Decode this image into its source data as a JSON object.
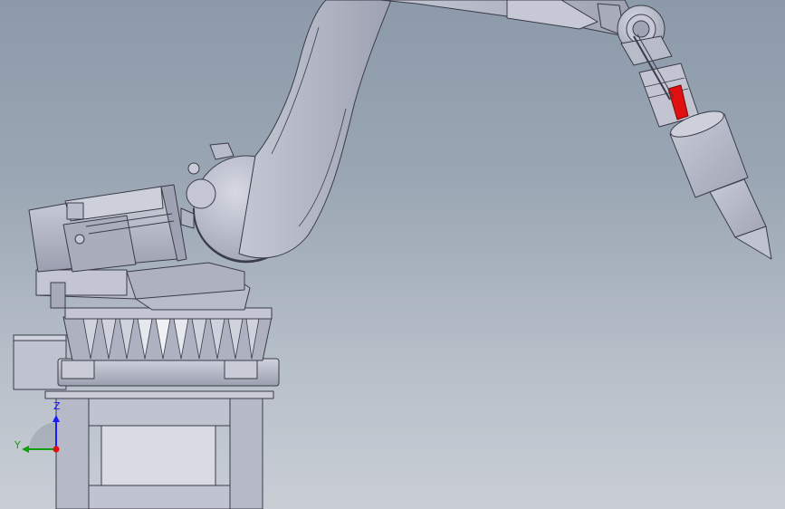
{
  "triad": {
    "z_label": "Z",
    "y_label": "Y",
    "z_color": "#1a1aff",
    "y_color": "#10a010",
    "x_color": "#e01010"
  },
  "colors": {
    "background_top": "#8c9aaa",
    "background_bottom": "#c9ced5",
    "part_fill": "#b4b8c6",
    "part_shade": "#9ca0b0",
    "part_light": "#d2d5e0",
    "edge": "#3a3c48",
    "highlight_red": "#e01010"
  }
}
